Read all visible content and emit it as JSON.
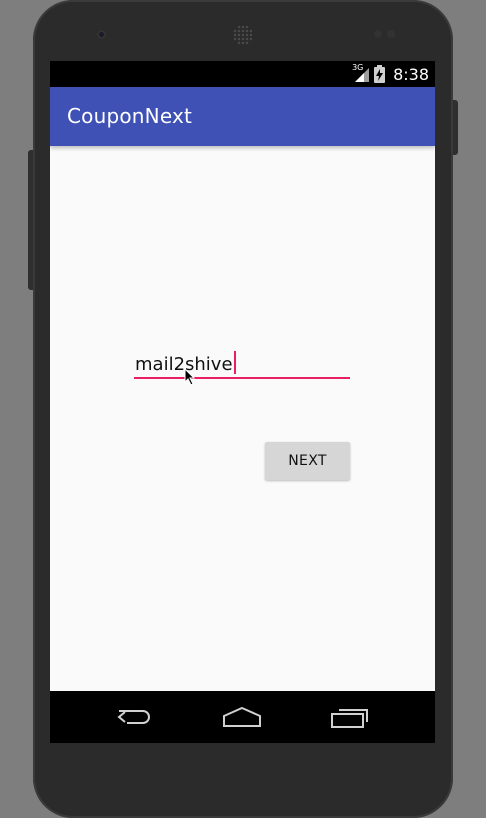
{
  "status_bar": {
    "network": "3G",
    "time": "8:38"
  },
  "app_bar": {
    "title": "CouponNext",
    "color": "#3f51b5"
  },
  "email_field": {
    "value": "mail2shive",
    "accent_color": "#e91e63"
  },
  "next_button": {
    "label": "NEXT"
  },
  "icons": {
    "status": [
      "signal-icon",
      "battery-icon"
    ],
    "navigation": [
      "back-icon",
      "home-icon",
      "recents-icon"
    ]
  }
}
